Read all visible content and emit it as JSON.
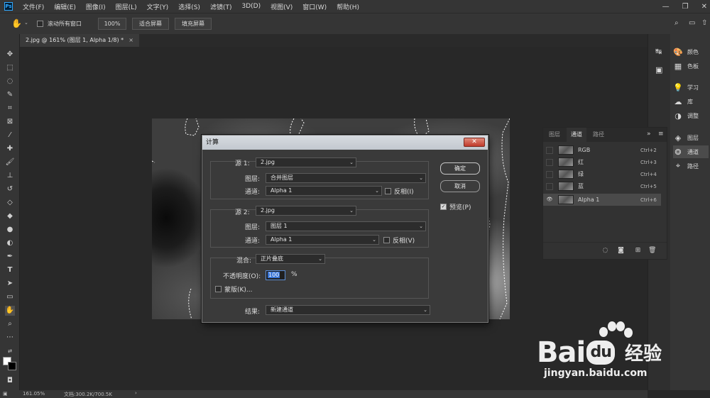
{
  "menubar": {
    "logo": "Ps",
    "items": [
      "文件(F)",
      "编辑(E)",
      "图像(I)",
      "图层(L)",
      "文字(Y)",
      "选择(S)",
      "滤镜(T)",
      "3D(D)",
      "视图(V)",
      "窗口(W)",
      "帮助(H)"
    ]
  },
  "options": {
    "scroll_all_label": "滚动所有窗口",
    "zoom_value": "100%",
    "fit_screen": "适合屏幕",
    "fill_screen": "填充屏幕"
  },
  "document": {
    "tab_title": "2.jpg @ 161% (图层 1, Alpha 1/8) *",
    "close_glyph": "×"
  },
  "right_panel": {
    "items": [
      {
        "icon": "palette-icon",
        "glyph": "🎨",
        "label": "颜色"
      },
      {
        "icon": "swatches-icon",
        "glyph": "▦",
        "label": "色板"
      },
      {
        "icon": "learn-icon",
        "glyph": "💡",
        "label": "学习"
      },
      {
        "icon": "libraries-icon",
        "glyph": "☁",
        "label": "库"
      },
      {
        "icon": "adjustments-icon",
        "glyph": "◑",
        "label": "调整"
      },
      {
        "icon": "layers-icon",
        "glyph": "◈",
        "label": "图层"
      },
      {
        "icon": "channels-icon",
        "glyph": "❂",
        "label": "通道"
      },
      {
        "icon": "paths-icon",
        "glyph": "⌖",
        "label": "路径"
      }
    ]
  },
  "channels_panel": {
    "tabs": [
      "图层",
      "通道",
      "路径"
    ],
    "active_tab": "通道",
    "rows": [
      {
        "name": "RGB",
        "shortcut": "Ctrl+2",
        "visible": false
      },
      {
        "name": "红",
        "shortcut": "Ctrl+3",
        "visible": false
      },
      {
        "name": "绿",
        "shortcut": "Ctrl+4",
        "visible": false
      },
      {
        "name": "蓝",
        "shortcut": "Ctrl+5",
        "visible": false
      },
      {
        "name": "Alpha 1",
        "shortcut": "Ctrl+6",
        "visible": true
      }
    ]
  },
  "dialog": {
    "title": "计算",
    "source1": {
      "label": "源 1:",
      "file": "2.jpg",
      "layer_label": "图层:",
      "layer": "合并图层",
      "channel_label": "通道:",
      "channel": "Alpha 1",
      "invert_label": "反相(I)"
    },
    "source2": {
      "label": "源 2:",
      "file": "2.jpg",
      "layer_label": "图层:",
      "layer": "图层 1",
      "channel_label": "通道:",
      "channel": "Alpha 1",
      "invert_label": "反相(V)"
    },
    "blend": {
      "label": "混合:",
      "mode": "正片叠底",
      "opacity_label": "不透明度(O):",
      "opacity": "100",
      "percent": "%",
      "mask_label": "蒙版(K)..."
    },
    "result": {
      "label": "结果:",
      "value": "新建通道"
    },
    "ok": "确定",
    "cancel": "取消",
    "preview_label": "预览(P)",
    "preview_checked": true
  },
  "status": {
    "zoom": "161.05%",
    "doc_info": "文档:300.2K/700.5K",
    "arrow": "›"
  },
  "watermark": {
    "brand": "Bai",
    "brand2": "du",
    "cn": "经验",
    "url": "jingyan.baidu.com"
  },
  "colors": {
    "accent": "#31a8ff",
    "selection": "#3875d7"
  }
}
